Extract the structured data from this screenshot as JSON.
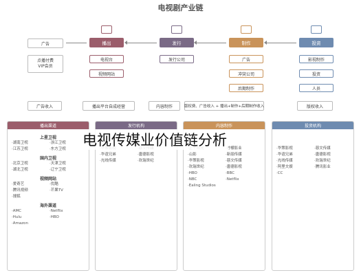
{
  "title": "电视剧产业链",
  "overlay_title": "电视传媒业价值链分析",
  "colors": {
    "broadcast": "#9b5d6b",
    "distribution": "#7a6a86",
    "production": "#c9935a",
    "investment": "#6e8bb0"
  },
  "flow": {
    "stages": [
      {
        "name": "播出",
        "icon": "tv-icon",
        "color": "#9b5d6b"
      },
      {
        "name": "发行",
        "icon": "megaphone-icon",
        "color": "#7a6a86"
      },
      {
        "name": "制作",
        "icon": "camera-icon",
        "color": "#c9935a"
      },
      {
        "name": "投资",
        "icon": "money-icon",
        "color": "#6e8bb0"
      }
    ],
    "ad": "广告",
    "pay_user": "点播付费\nVIP会员",
    "broadcast_items": [
      "电视台",
      "视频网站"
    ],
    "distribution_items": [
      "发行公司"
    ],
    "production_items": [
      "广告",
      "冲突公司",
      "后期制作"
    ],
    "investment_items": [
      "影视制作",
      "投资",
      "人员"
    ],
    "bottom_left": [
      "广告收入",
      "播出平台自成经营"
    ],
    "bottom_right": [
      "内容制作",
      "版权费、广告收入 + 播出+制作+后期制作收入",
      "版权收入"
    ]
  },
  "panels": [
    {
      "header": "播出渠道",
      "color": "#9b5d6b",
      "sections": [
        {
          "title": "上星卫视",
          "items": [
            "·湖南卫视",
            "·浙江卫视",
            "·江苏卫视",
            "·东方卫视"
          ]
        },
        {
          "title": "国内卫视",
          "items": [
            "·北京卫视",
            "·天津卫视",
            "·湖北卫视",
            "·辽宁卫视"
          ]
        },
        {
          "title": "视频网站",
          "items": [
            "·爱奇艺",
            "·优酷",
            "·腾讯视频",
            "·芒果TV",
            "·搜狐"
          ]
        },
        {
          "title": "海外渠道",
          "items": [
            "·AMC",
            "·Netflix",
            "·Hulu",
            "·HBO",
            "·Amazon"
          ]
        }
      ]
    },
    {
      "header": "发行机构",
      "color": "#7a6a86",
      "items": [
        "·华策影视",
        "·慈文传媒",
        "·华谊兄弟",
        "·唐德影视",
        "·光线传媒",
        "·欢瑞世纪"
      ]
    },
    {
      "header": "内容制作",
      "color": "#c9935a",
      "items": [
        "·正午阳光",
        "·柠檬影业",
        "·山影",
        "·新丽传媒",
        "·华策影视",
        "·慈文传媒",
        "·欢瑞世纪",
        "·唐德影视",
        "·HBO",
        "·BBC",
        "·NBC",
        "·Netflix",
        "·Ealing Studios"
      ]
    },
    {
      "header": "投资机构",
      "color": "#6e8bb0",
      "items": [
        "·华策影视",
        "·慈文传媒",
        "·华谊兄弟",
        "·唐德影视",
        "·光线传媒",
        "·欢瑞世纪",
        "·阿里文娱",
        "·腾讯影业",
        "·CC"
      ]
    }
  ]
}
